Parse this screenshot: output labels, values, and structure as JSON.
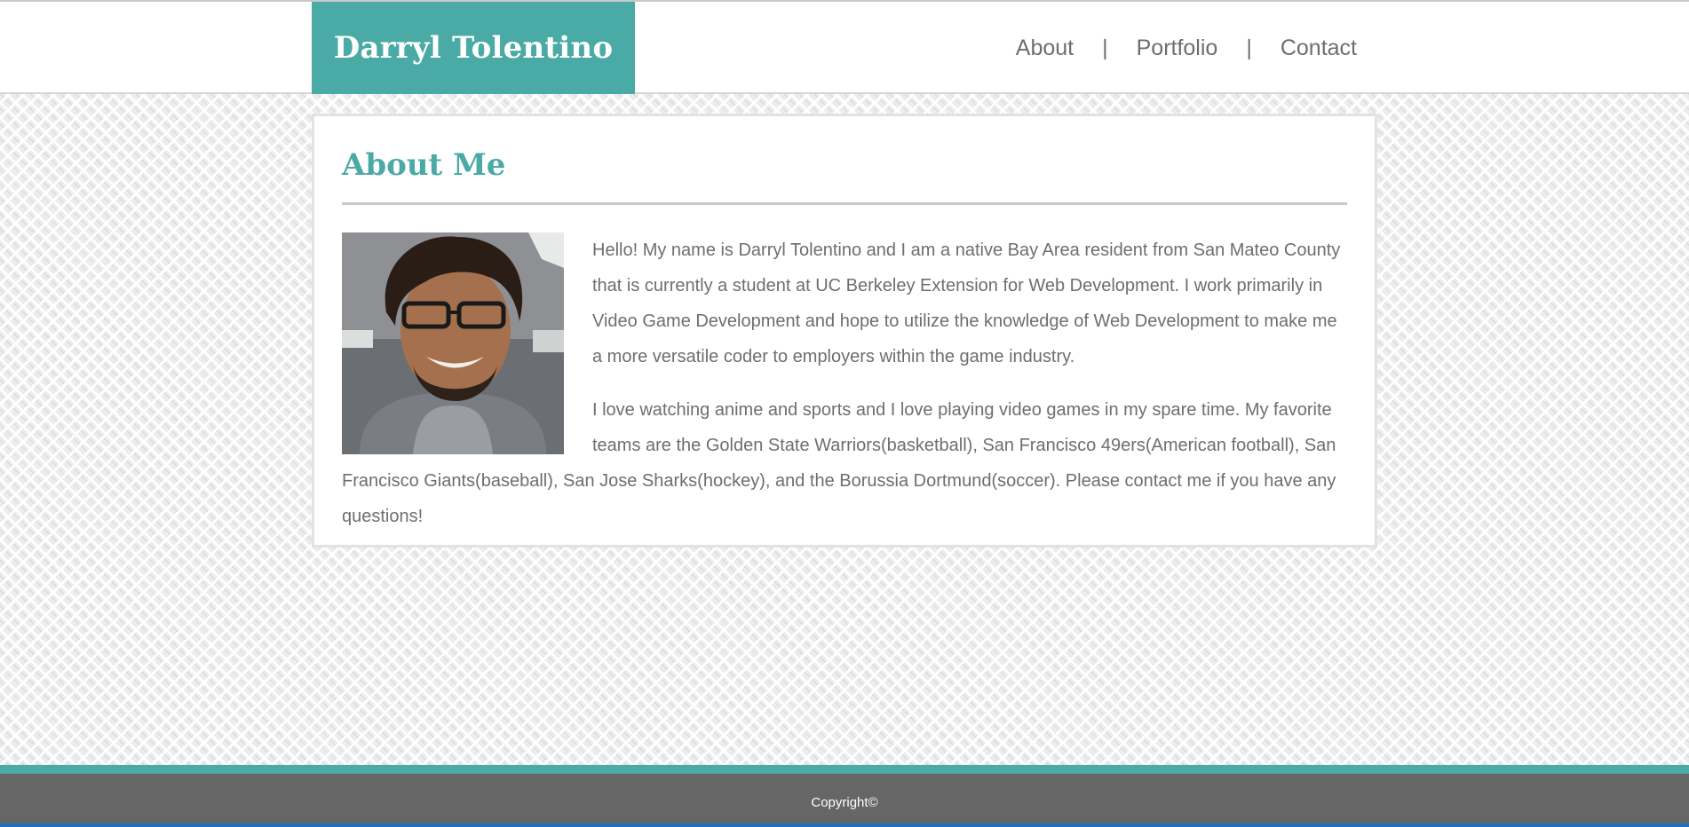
{
  "header": {
    "brand": "Darryl Tolentino",
    "nav": {
      "about": "About",
      "portfolio": "Portfolio",
      "contact": "Contact",
      "separator": "|"
    }
  },
  "about": {
    "title": "About Me",
    "paragraph1": "Hello! My name is Darryl Tolentino and I am a native Bay Area resident from San Mateo County that is currently a student at UC Berkeley Extension for Web Development. I work primarily in Video Game Development and hope to utilize the knowledge of Web Development to make me a more versatile coder to employers within the game industry.",
    "paragraph2": "I love watching anime and sports and I love playing video games in my spare time. My favorite teams are the Golden State Warriors(basketball), San Francisco 49ers(American football), San Francisco Giants(baseball), San Jose Sharks(hockey), and the Borussia Dortmund(soccer). Please contact me if you have any questions!"
  },
  "footer": {
    "copyright": "Copyright©"
  },
  "colors": {
    "accent": "#4aaaa5",
    "text": "#6e6e6e",
    "footer_bg": "#666666"
  }
}
